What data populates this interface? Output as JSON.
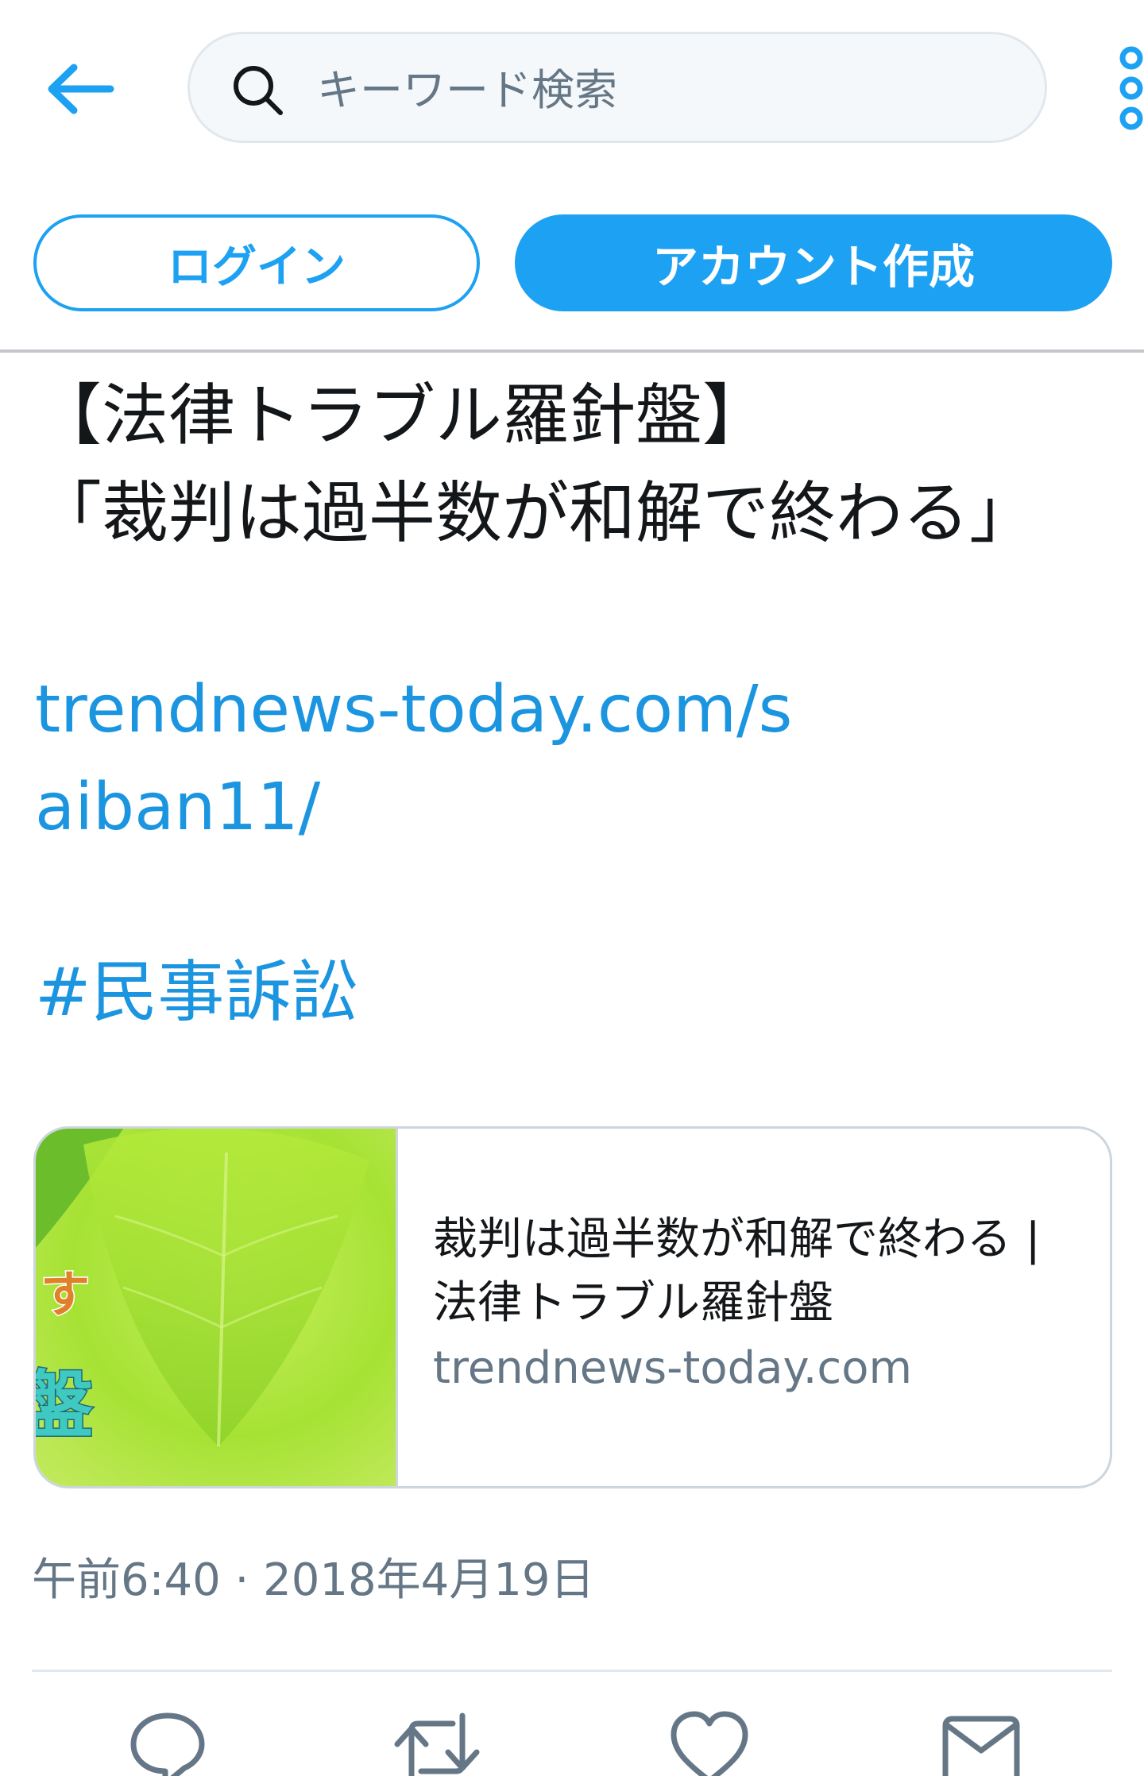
{
  "header": {
    "back_icon": "arrow-left-icon",
    "search": {
      "placeholder": "キーワード検索",
      "value": "",
      "icon": "search-icon"
    },
    "more_icon": "more-vertical-icon"
  },
  "auth": {
    "login_label": "ログイン",
    "signup_label": "アカウント作成"
  },
  "tweet": {
    "text": "【法律トラブル羅針盤】\n「裁判は過半数が和解で終わる」",
    "link": "trendnews-today.com/saiban11/",
    "hashtag": "#民事訴訟",
    "card": {
      "title": "裁判は過半数が和解で終わる | 法律トラブル羅針盤",
      "domain": "trendnews-today.com",
      "thumb_text_1": "す",
      "thumb_text_2": "盤"
    },
    "timestamp": "午前6:40 · 2018年4月19日"
  },
  "actions": {
    "reply_icon": "reply-icon",
    "retweet_icon": "retweet-icon",
    "like_icon": "heart-icon",
    "message_icon": "envelope-icon"
  },
  "colors": {
    "accent": "#1da1f2",
    "link": "#1b95e0",
    "secondary_text": "#657786",
    "border": "#ccd6dd"
  }
}
